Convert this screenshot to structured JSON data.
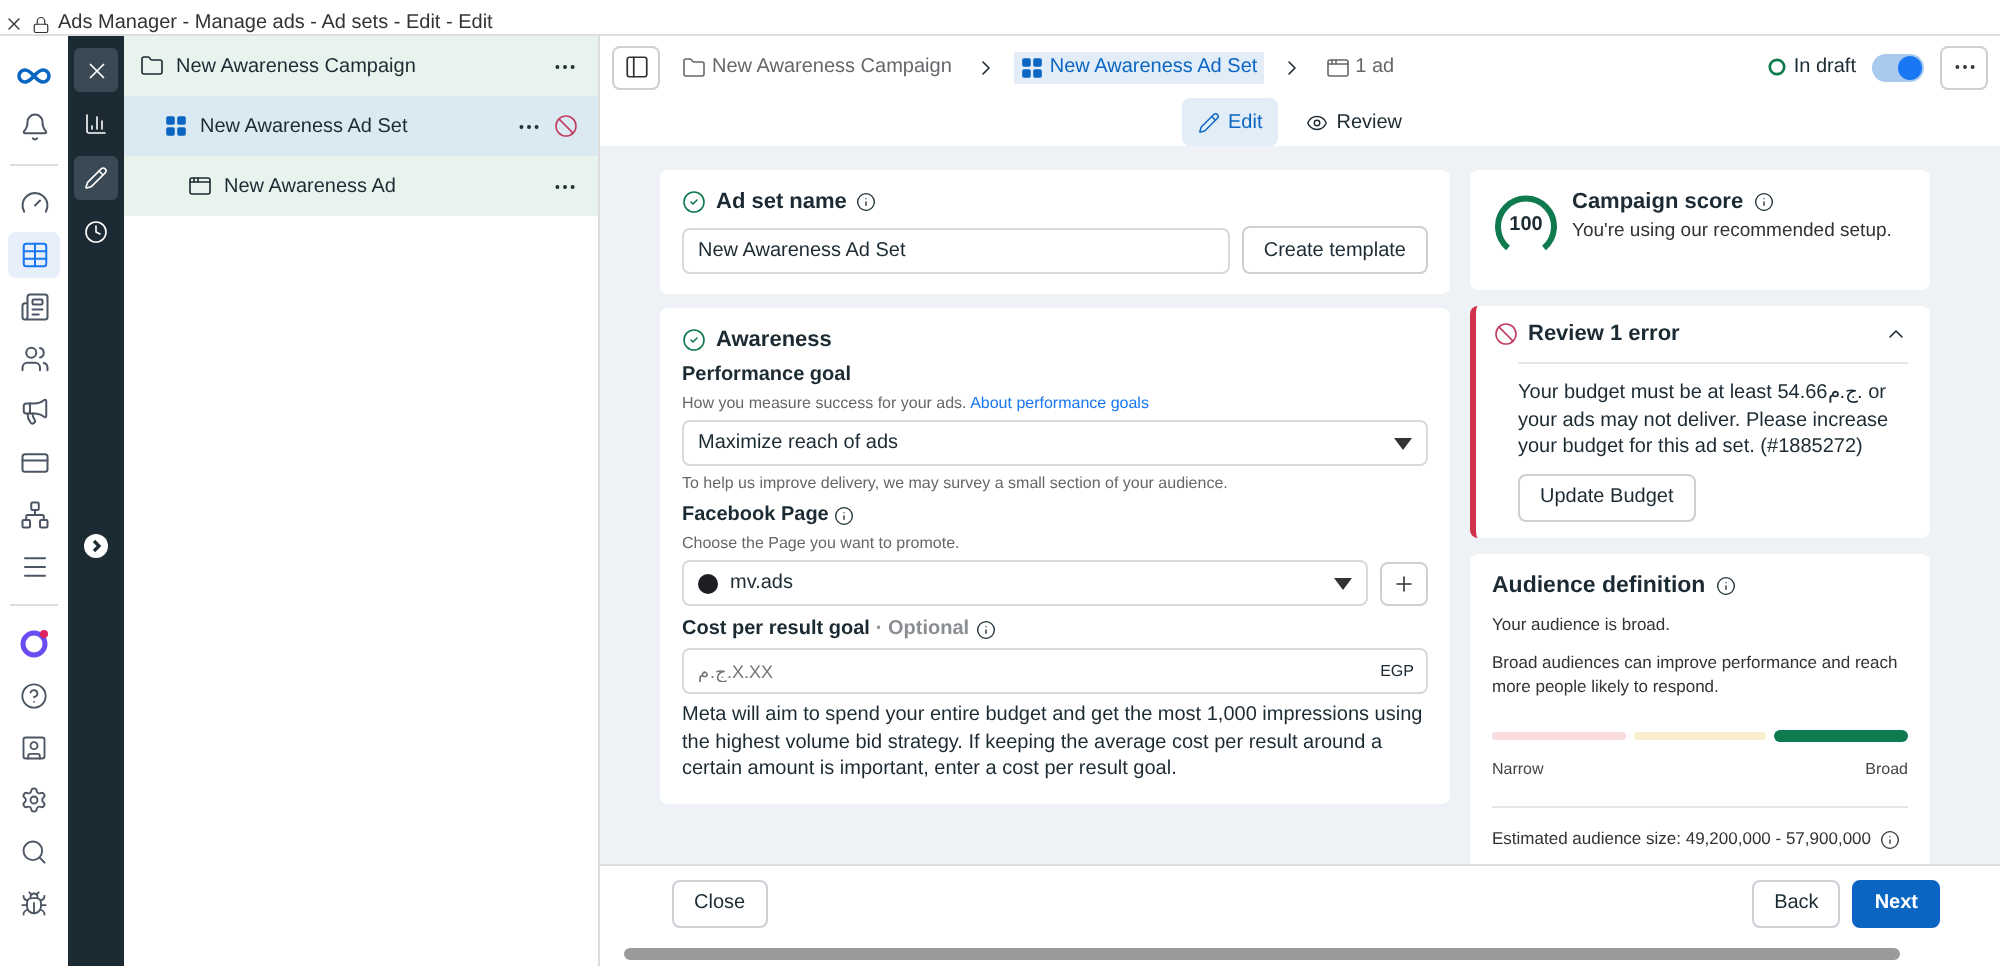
{
  "browser": {
    "title": "Ads Manager - Manage ads - Ad sets - Edit - Edit"
  },
  "nav_rail": [
    {
      "selected": false
    },
    {
      "selected": true
    },
    {
      "selected": false
    },
    {
      "selected": false
    },
    {
      "selected": false
    },
    {
      "selected": false
    },
    {
      "selected": false
    },
    {
      "selected": false
    }
  ],
  "tool_rail": [
    {
      "selected": false
    },
    {
      "selected": true
    },
    {
      "selected": false
    }
  ],
  "tree": [
    {
      "label": "New Awareness Campaign",
      "kind": "campaign",
      "selected": false,
      "error": false,
      "children": [
        {
          "label": "New Awareness Ad Set",
          "kind": "ad_set",
          "selected": true,
          "error": true,
          "children": [
            {
              "label": "New Awareness Ad",
              "kind": "ad",
              "selected": false,
              "error": false
            }
          ]
        }
      ]
    }
  ],
  "breadcrumbs": [
    {
      "label": "New Awareness Campaign",
      "kind": "campaign",
      "selected": false
    },
    {
      "label": "New Awareness Ad Set",
      "kind": "ad_set",
      "selected": true
    },
    {
      "label": "1 ad",
      "kind": "ad",
      "selected": false
    }
  ],
  "status": {
    "label": "In draft",
    "on": true
  },
  "tabs": [
    {
      "label": "Edit",
      "kind": "edit",
      "selected": true
    },
    {
      "label": "Review",
      "kind": "review",
      "selected": false
    }
  ],
  "ad_set_name": {
    "title": "Ad set name",
    "value": "New Awareness Ad Set",
    "button": "Create template"
  },
  "awareness": {
    "title": "Awareness",
    "performance_goal": {
      "label": "Performance goal",
      "hint": "How you measure success for your ads.",
      "link": "About performance goals",
      "value": "Maximize reach of ads",
      "note": "To help us improve delivery, we may survey a small section of your audience."
    },
    "facebook_page": {
      "label": "Facebook Page",
      "hint": "Choose the Page you want to promote.",
      "value": "mv.ads"
    },
    "cost_goal": {
      "label": "Cost per result goal",
      "optional": "· Optional",
      "placeholder": "ج.م.X.XX",
      "currency": "EGP",
      "description": "Meta will aim to spend your entire budget and get the most 1,000 impressions using the highest volume bid strategy. If keeping the average cost per result around a certain amount is important, enter a cost per result goal."
    }
  },
  "score": {
    "value": "100",
    "title": "Campaign score",
    "text": "You're using our recommended setup."
  },
  "error": {
    "title": "Review 1 error",
    "expanded": true,
    "message": "Your budget must be at least 54.66ج.م. or your ads may not deliver. Please increase your budget for this ad set. (#1885272)",
    "button": "Update Budget"
  },
  "audience": {
    "title": "Audience definition",
    "status": "Your audience is broad.",
    "text": "Broad audiences can improve performance and reach more people likely to respond.",
    "segments": [
      {
        "selected": false,
        "color": "#f9dbe0"
      },
      {
        "selected": false,
        "color": "#f8edcc"
      },
      {
        "selected": true,
        "color": "#0e7a4d"
      }
    ],
    "scale_low": "Narrow",
    "scale_high": "Broad",
    "estimate": "Estimated audience size: 49,200,000 - 57,900,000"
  },
  "footer": {
    "close": "Close",
    "back": "Back",
    "next": "Next"
  }
}
